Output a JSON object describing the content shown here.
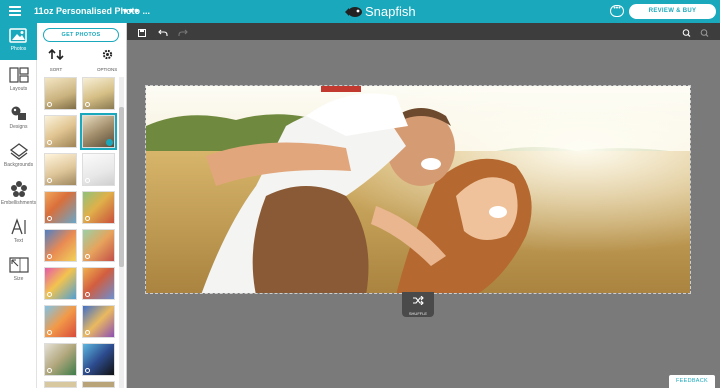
{
  "header": {
    "title": "11oz Personalised Photo ...",
    "more_label": "•••",
    "brand": "Snapfish",
    "chat_label": "•••",
    "review_label": "REVIEW & BUY"
  },
  "rail": {
    "items": [
      {
        "label": "Photos",
        "icon": "photos-icon"
      },
      {
        "label": "Layouts",
        "icon": "layouts-icon"
      },
      {
        "label": "Designs",
        "icon": "designs-icon"
      },
      {
        "label": "Backgrounds",
        "icon": "backgrounds-icon"
      },
      {
        "label": "Embellishments",
        "icon": "embellishments-icon"
      },
      {
        "label": "Text",
        "icon": "text-icon"
      },
      {
        "label": "Size",
        "icon": "size-icon"
      }
    ]
  },
  "panel": {
    "get_photos_label": "GET PHOTOS",
    "sort_label": "SORT",
    "options_label": "OPTIONS"
  },
  "toolbar": {
    "save_label": "SAVE",
    "undo_label": "UNDO",
    "redo_label": "REDO",
    "zoom_label": "ZOOM"
  },
  "canvas": {
    "shuffle_label": "SHUFFLE"
  },
  "feedback_label": "FEEDBACK",
  "colors": {
    "accent": "#1aa9bc",
    "toolbar": "#3d3d3d",
    "workspace": "#7a7a7a"
  }
}
